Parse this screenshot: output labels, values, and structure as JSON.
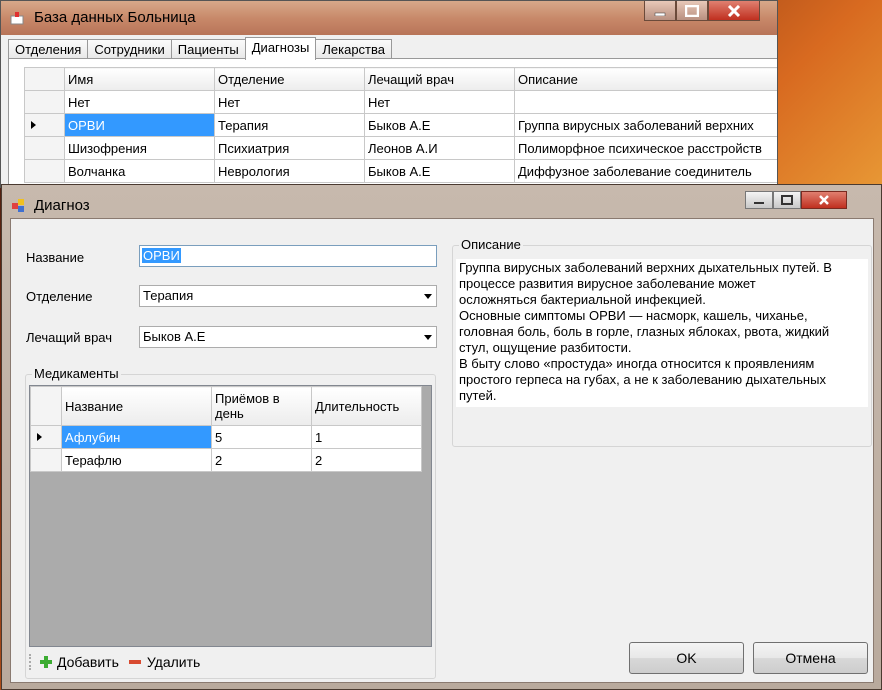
{
  "main_window": {
    "title": "База данных Больница",
    "tabs": [
      "Отделения",
      "Сотрудники",
      "Пациенты",
      "Диагнозы",
      "Лекарства"
    ],
    "active_tab": "Диагнозы",
    "grid": {
      "columns": [
        "Имя",
        "Отделение",
        "Лечащий врач",
        "Описание"
      ],
      "rows": [
        [
          "Нет",
          "Нет",
          "Нет",
          ""
        ],
        [
          "ОРВИ",
          "Терапия",
          "Быков А.Е",
          "Группа вирусных заболеваний верхних"
        ],
        [
          "Шизофрения",
          "Психиатрия",
          "Леонов А.И",
          "Полиморфное психическое расстройств"
        ],
        [
          "Волчанка",
          "Неврология",
          "Быков А.Е",
          "Диффузное заболевание соединитель"
        ]
      ],
      "current_row": 1
    }
  },
  "dialog": {
    "title": "Диагноз",
    "name_label": "Название",
    "name_value": "ОРВИ",
    "department_label": "Отделение",
    "department_value": "Терапия",
    "doctor_label": "Лечащий врач",
    "doctor_value": "Быков А.Е",
    "description_label": "Описание",
    "description_text": "Группа вирусных заболеваний верхних дыхательных путей. В\nпроцессе развития вирусное заболевание может\nосложняться бактериальной инфекцией.\nОсновные симптомы ОРВИ — насморк, кашель, чиханье,\nголовная боль, боль в горле, глазных яблоках, рвота, жидкий\nстул, ощущение разбитости.\nВ быту слово «простуда» иногда относится к проявлениям\nпростого герпеса на губах, а не к заболеванию дыхательных\nпутей.",
    "medications_label": "Медикаменты",
    "med_grid": {
      "columns": [
        "Название",
        "Приёмов в день",
        "Длительность"
      ],
      "rows": [
        [
          "Афлубин",
          "5",
          "1"
        ],
        [
          "Терафлю",
          "2",
          "2"
        ]
      ]
    },
    "add_label": "Добавить",
    "delete_label": "Удалить",
    "ok_label": "OK",
    "cancel_label": "Отмена"
  },
  "colors": {
    "selection": "#3399ff",
    "add_icon": "#3cac32",
    "delete_icon": "#d84a30"
  }
}
